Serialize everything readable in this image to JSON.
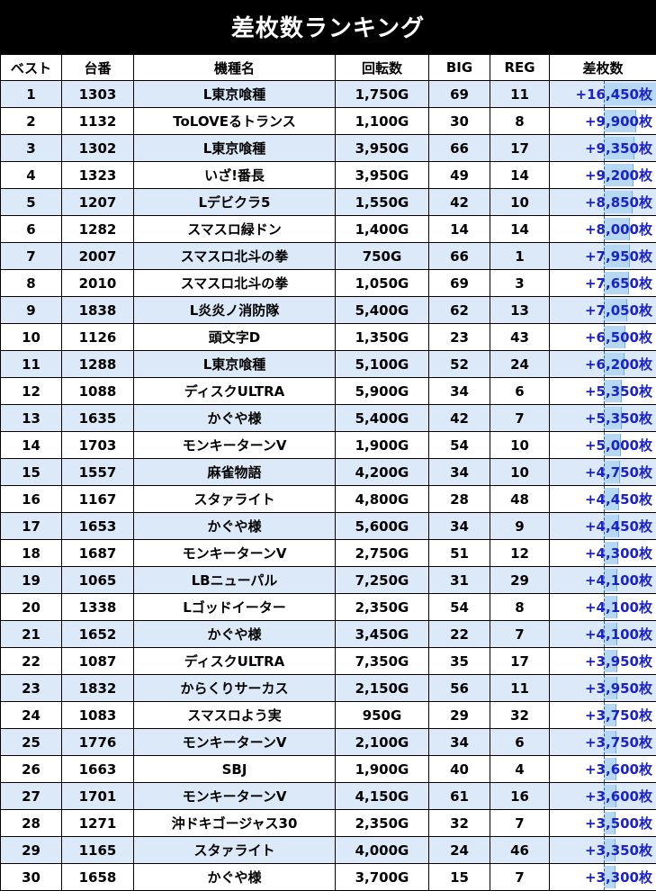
{
  "title": "差枚数ランキング",
  "headers": [
    "ベスト",
    "台番",
    "機種名",
    "回転数",
    "BIG",
    "REG",
    "差枚数"
  ],
  "colors": {
    "header_bg": "#000000",
    "row_alt": "#dce9f8",
    "diff_text": "#1a22c8",
    "bar": "#b7d8f3"
  },
  "rows": [
    {
      "rank": "1",
      "machine_no": "1303",
      "model": "L東京喰種",
      "spins": "1,750G",
      "big": "69",
      "reg": "11",
      "diff": "+16,450枚",
      "diff_value": 16450
    },
    {
      "rank": "2",
      "machine_no": "1132",
      "model": "ToLOVEるトランス",
      "spins": "1,100G",
      "big": "30",
      "reg": "8",
      "diff": "+9,900枚",
      "diff_value": 9900
    },
    {
      "rank": "3",
      "machine_no": "1302",
      "model": "L東京喰種",
      "spins": "3,950G",
      "big": "66",
      "reg": "17",
      "diff": "+9,350枚",
      "diff_value": 9350
    },
    {
      "rank": "4",
      "machine_no": "1323",
      "model": "いざ!番長",
      "spins": "3,950G",
      "big": "49",
      "reg": "14",
      "diff": "+9,200枚",
      "diff_value": 9200
    },
    {
      "rank": "5",
      "machine_no": "1207",
      "model": "Lデビクラ5",
      "spins": "1,550G",
      "big": "42",
      "reg": "10",
      "diff": "+8,850枚",
      "diff_value": 8850
    },
    {
      "rank": "6",
      "machine_no": "1282",
      "model": "スマスロ緑ドン",
      "spins": "1,400G",
      "big": "14",
      "reg": "14",
      "diff": "+8,000枚",
      "diff_value": 8000
    },
    {
      "rank": "7",
      "machine_no": "2007",
      "model": "スマスロ北斗の拳",
      "spins": "750G",
      "big": "66",
      "reg": "1",
      "diff": "+7,950枚",
      "diff_value": 7950
    },
    {
      "rank": "8",
      "machine_no": "2010",
      "model": "スマスロ北斗の拳",
      "spins": "1,050G",
      "big": "69",
      "reg": "3",
      "diff": "+7,650枚",
      "diff_value": 7650
    },
    {
      "rank": "9",
      "machine_no": "1838",
      "model": "L炎炎ノ消防隊",
      "spins": "5,400G",
      "big": "62",
      "reg": "13",
      "diff": "+7,050枚",
      "diff_value": 7050
    },
    {
      "rank": "10",
      "machine_no": "1126",
      "model": "頭文字D",
      "spins": "1,350G",
      "big": "23",
      "reg": "43",
      "diff": "+6,500枚",
      "diff_value": 6500
    },
    {
      "rank": "11",
      "machine_no": "1288",
      "model": "L東京喰種",
      "spins": "5,100G",
      "big": "52",
      "reg": "24",
      "diff": "+6,200枚",
      "diff_value": 6200
    },
    {
      "rank": "12",
      "machine_no": "1088",
      "model": "ディスクULTRA",
      "spins": "5,900G",
      "big": "34",
      "reg": "6",
      "diff": "+5,350枚",
      "diff_value": 5350
    },
    {
      "rank": "13",
      "machine_no": "1635",
      "model": "かぐや様",
      "spins": "5,400G",
      "big": "42",
      "reg": "7",
      "diff": "+5,350枚",
      "diff_value": 5350
    },
    {
      "rank": "14",
      "machine_no": "1703",
      "model": "モンキーターンV",
      "spins": "1,900G",
      "big": "54",
      "reg": "10",
      "diff": "+5,000枚",
      "diff_value": 5000
    },
    {
      "rank": "15",
      "machine_no": "1557",
      "model": "麻雀物語",
      "spins": "4,200G",
      "big": "34",
      "reg": "10",
      "diff": "+4,750枚",
      "diff_value": 4750
    },
    {
      "rank": "16",
      "machine_no": "1167",
      "model": "スタァライト",
      "spins": "4,800G",
      "big": "28",
      "reg": "48",
      "diff": "+4,450枚",
      "diff_value": 4450
    },
    {
      "rank": "17",
      "machine_no": "1653",
      "model": "かぐや様",
      "spins": "5,600G",
      "big": "34",
      "reg": "9",
      "diff": "+4,450枚",
      "diff_value": 4450
    },
    {
      "rank": "18",
      "machine_no": "1687",
      "model": "モンキーターンV",
      "spins": "2,750G",
      "big": "51",
      "reg": "12",
      "diff": "+4,300枚",
      "diff_value": 4300
    },
    {
      "rank": "19",
      "machine_no": "1065",
      "model": "LBニューパル",
      "spins": "7,250G",
      "big": "31",
      "reg": "29",
      "diff": "+4,100枚",
      "diff_value": 4100
    },
    {
      "rank": "20",
      "machine_no": "1338",
      "model": "Lゴッドイーター",
      "spins": "2,350G",
      "big": "54",
      "reg": "8",
      "diff": "+4,100枚",
      "diff_value": 4100
    },
    {
      "rank": "21",
      "machine_no": "1652",
      "model": "かぐや様",
      "spins": "3,450G",
      "big": "22",
      "reg": "7",
      "diff": "+4,100枚",
      "diff_value": 4100
    },
    {
      "rank": "22",
      "machine_no": "1087",
      "model": "ディスクULTRA",
      "spins": "7,350G",
      "big": "35",
      "reg": "17",
      "diff": "+3,950枚",
      "diff_value": 3950
    },
    {
      "rank": "23",
      "machine_no": "1832",
      "model": "からくりサーカス",
      "spins": "2,150G",
      "big": "56",
      "reg": "11",
      "diff": "+3,950枚",
      "diff_value": 3950
    },
    {
      "rank": "24",
      "machine_no": "1083",
      "model": "スマスロよう実",
      "spins": "950G",
      "big": "29",
      "reg": "32",
      "diff": "+3,750枚",
      "diff_value": 3750
    },
    {
      "rank": "25",
      "machine_no": "1776",
      "model": "モンキーターンV",
      "spins": "2,100G",
      "big": "34",
      "reg": "6",
      "diff": "+3,750枚",
      "diff_value": 3750
    },
    {
      "rank": "26",
      "machine_no": "1663",
      "model": "SBJ",
      "spins": "1,900G",
      "big": "40",
      "reg": "4",
      "diff": "+3,600枚",
      "diff_value": 3600
    },
    {
      "rank": "27",
      "machine_no": "1701",
      "model": "モンキーターンV",
      "spins": "4,150G",
      "big": "61",
      "reg": "16",
      "diff": "+3,600枚",
      "diff_value": 3600
    },
    {
      "rank": "28",
      "machine_no": "1271",
      "model": "沖ドキゴージャス30",
      "spins": "2,350G",
      "big": "32",
      "reg": "7",
      "diff": "+3,500枚",
      "diff_value": 3500
    },
    {
      "rank": "29",
      "machine_no": "1165",
      "model": "スタァライト",
      "spins": "4,000G",
      "big": "24",
      "reg": "46",
      "diff": "+3,350枚",
      "diff_value": 3350
    },
    {
      "rank": "30",
      "machine_no": "1658",
      "model": "かぐや様",
      "spins": "3,700G",
      "big": "15",
      "reg": "7",
      "diff": "+3,300枚",
      "diff_value": 3300
    }
  ]
}
